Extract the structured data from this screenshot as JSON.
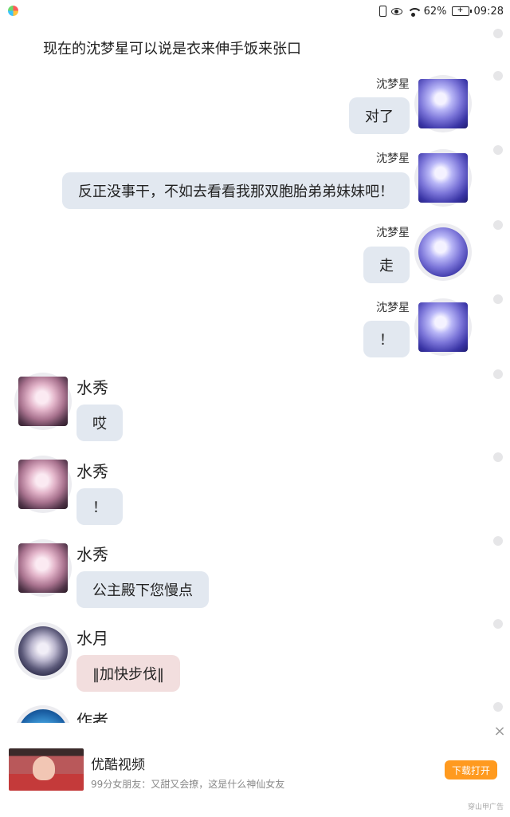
{
  "status_bar": {
    "battery": "62%",
    "time": "09:28"
  },
  "narration": "现在的沈梦星可以说是衣来伸手饭来张口",
  "messages": [
    {
      "side": "right",
      "sender": "沈梦星",
      "text": "对了",
      "avatar": "blue"
    },
    {
      "side": "right",
      "sender": "沈梦星",
      "text": "反正没事干，不如去看看我那双胞胎弟弟妹妹吧！",
      "avatar": "blue"
    },
    {
      "side": "right",
      "sender": "沈梦星",
      "text": "走",
      "avatar": "blue-round"
    },
    {
      "side": "right",
      "sender": "沈梦星",
      "text": "！",
      "avatar": "blue"
    },
    {
      "side": "left",
      "sender": "水秀",
      "text": "哎",
      "avatar": "pink"
    },
    {
      "side": "left",
      "sender": "水秀",
      "text": "！",
      "avatar": "pink"
    },
    {
      "side": "left",
      "sender": "水秀",
      "text": "公主殿下您慢点",
      "avatar": "pink"
    },
    {
      "side": "left",
      "sender": "水月",
      "text": "‖加快步伐‖",
      "avatar": "moon"
    },
    {
      "side": "left",
      "sender": "作者",
      "text": "",
      "avatar": "earth"
    }
  ],
  "ad": {
    "title": "优酷视频",
    "description": "99分女朋友：又甜又会撩，这是什么神仙女友",
    "button_label": "下载打开",
    "close_icon": "×",
    "source": "穿山甲广告"
  }
}
